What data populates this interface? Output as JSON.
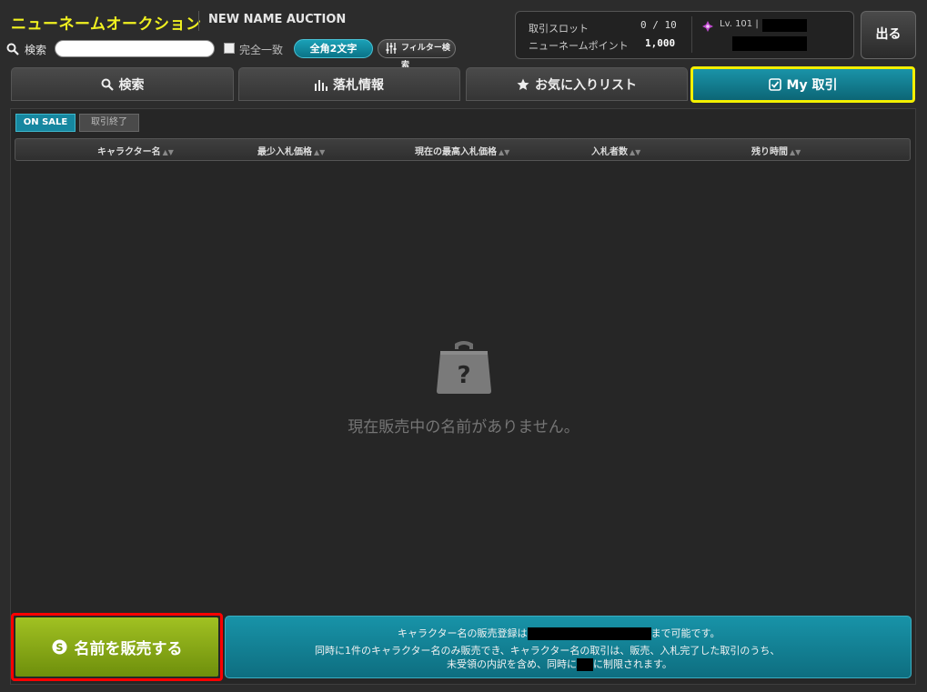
{
  "header": {
    "title": "ニューネームオークション",
    "subtitle": "NEW NAME AUCTION",
    "search_label": "検索",
    "search_placeholder": "",
    "exact_match_label": "完全一致",
    "fullwidth_button": "全角2文字",
    "filter_button": "フィルター検索",
    "exit_button": "出る"
  },
  "info": {
    "slot_label": "取引スロット",
    "slot_value": "0 / 10",
    "point_label": "ニューネームポイント",
    "point_value": "1,000",
    "level_text": "Lv. 101 |"
  },
  "tabs": [
    {
      "label": "検索",
      "icon": "search-icon"
    },
    {
      "label": "落札情報",
      "icon": "bar-chart-icon"
    },
    {
      "label": "お気に入りリスト",
      "icon": "star-icon"
    },
    {
      "label": "My 取引",
      "icon": "checkbox-icon",
      "active": true
    }
  ],
  "filters": {
    "on_sale": "ON SALE",
    "ended": "取引終了"
  },
  "table": {
    "columns": [
      "キャラクター名",
      "最少入札価格",
      "現在の最高入札価格",
      "入札者数",
      "残り時間"
    ]
  },
  "empty_state": {
    "text": "現在販売中の名前がありません。",
    "icon": "question-box-icon"
  },
  "sell": {
    "label": "名前を販売する",
    "icon": "dollar-coin-icon"
  },
  "notice": {
    "line1_prefix": "キャラクター名の販売登録は",
    "line1_suffix": "まで可能です。",
    "line2": "同時に1件のキャラクター名のみ販売でき、キャラクター名の取引は、販売、入札完了した取引のうち、",
    "line3_prefix": "未受領の内訳を含め、同時に",
    "line3_suffix": "に制限されます。"
  },
  "colors": {
    "title": "#f0f020",
    "accent": "#1687a0",
    "sell_button": "#8aaa18",
    "highlight_yellow": "#f4f000",
    "highlight_red": "#ff0000"
  }
}
